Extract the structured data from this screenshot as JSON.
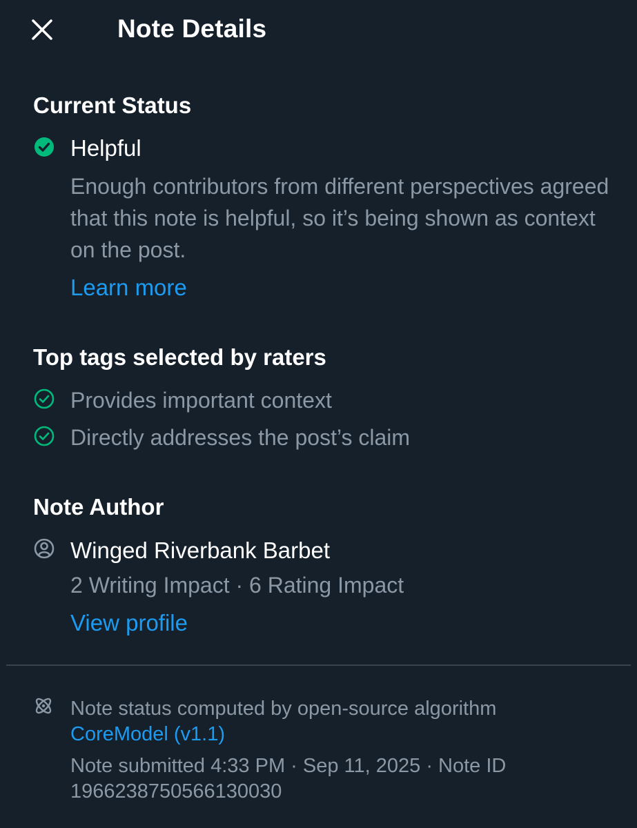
{
  "header": {
    "title": "Note Details"
  },
  "current_status": {
    "heading": "Current Status",
    "status": "Helpful",
    "description": "Enough contributors from different perspectives agreed that this note is helpful, so it’s being shown as context on the post.",
    "learn_more": "Learn more"
  },
  "top_tags": {
    "heading": "Top tags selected by raters",
    "tags": [
      "Provides important context",
      "Directly addresses the post’s claim"
    ]
  },
  "note_author": {
    "heading": "Note Author",
    "name": "Winged Riverbank Barbet",
    "impact": "2 Writing Impact · 6 Rating Impact",
    "view_profile": "View profile"
  },
  "footer": {
    "algorithm_text": "Note status computed by open-source algorithm",
    "algorithm_link": "CoreModel (v1.1)",
    "submitted": "Note submitted 4:33 PM · Sep 11, 2025 · Note ID",
    "note_id": "1966238750566130030"
  },
  "colors": {
    "background": "#15202b",
    "accent": "#1d9bf0",
    "success": "#00ba7c",
    "secondary_text": "#8b98a5"
  },
  "icons": {
    "close": "close-icon",
    "status": "check-circle-filled-icon",
    "tag": "check-circle-outline-icon",
    "author": "user-circle-icon",
    "algorithm": "atom-icon"
  }
}
